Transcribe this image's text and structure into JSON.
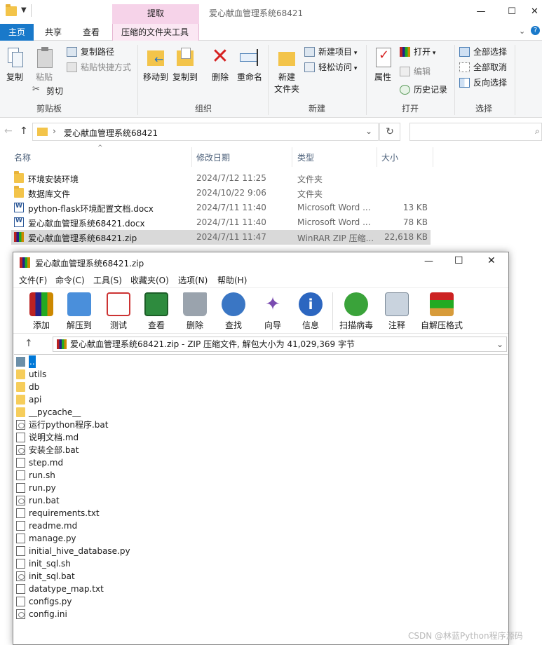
{
  "explorer": {
    "window_title": "爱心献血管理系统68421",
    "context_tab_header": "提取",
    "tabs": [
      "主页",
      "共享",
      "查看",
      "压缩的文件夹工具"
    ],
    "ribbon": {
      "clipboard": {
        "label": "剪贴板",
        "copy": "复制",
        "paste": "粘贴",
        "copy_path": "复制路径",
        "paste_shortcut": "粘贴快捷方式",
        "cut": "剪切"
      },
      "organize": {
        "label": "组织",
        "move_to": "移动到",
        "copy_to": "复制到",
        "delete": "删除",
        "rename": "重命名"
      },
      "new": {
        "label": "新建",
        "new_folder": "新建\n文件夹",
        "new_item": "新建项目",
        "easy_access": "轻松访问"
      },
      "open": {
        "label": "打开",
        "properties": "属性",
        "open": "打开",
        "edit": "编辑",
        "history": "历史记录"
      },
      "select": {
        "label": "选择",
        "select_all": "全部选择",
        "select_none": "全部取消",
        "invert": "反向选择"
      }
    },
    "address": {
      "path": "爱心献血管理系统68421"
    },
    "columns": {
      "name": "名称",
      "modified": "修改日期",
      "type": "类型",
      "size": "大小"
    },
    "files": [
      {
        "name": "环境安装环境",
        "modified": "2024/7/12 11:25",
        "type": "文件夹",
        "size": "",
        "icon": "folder-icon"
      },
      {
        "name": "数据库文件",
        "modified": "2024/10/22 9:06",
        "type": "文件夹",
        "size": "",
        "icon": "folder-icon"
      },
      {
        "name": "python-flask环境配置文档.docx",
        "modified": "2024/7/11 11:40",
        "type": "Microsoft Word ...",
        "size": "13 KB",
        "icon": "word-doc-icon"
      },
      {
        "name": "爱心献血管理系统68421.docx",
        "modified": "2024/7/11 11:40",
        "type": "Microsoft Word ...",
        "size": "78 KB",
        "icon": "word-doc-icon"
      },
      {
        "name": "爱心献血管理系统68421.zip",
        "modified": "2024/7/11 11:47",
        "type": "WinRAR ZIP 压缩...",
        "size": "22,618 KB",
        "icon": "winrar-zip-icon"
      }
    ]
  },
  "winrar": {
    "title": "爱心献血管理系统68421.zip",
    "menu": [
      "文件(F)",
      "命令(C)",
      "工具(S)",
      "收藏夹(O)",
      "选项(N)",
      "帮助(H)"
    ],
    "toolbar": [
      "添加",
      "解压到",
      "测试",
      "查看",
      "删除",
      "查找",
      "向导",
      "信息",
      "扫描病毒",
      "注释",
      "自解压格式"
    ],
    "path_text": "爱心献血管理系统68421.zip - ZIP 压缩文件, 解包大小为 41,029,369 字节",
    "items": [
      {
        "name": "..",
        "kind": "up"
      },
      {
        "name": "utils",
        "kind": "fold"
      },
      {
        "name": "db",
        "kind": "fold"
      },
      {
        "name": "api",
        "kind": "fold"
      },
      {
        "name": "__pycache__",
        "kind": "fold"
      },
      {
        "name": "运行python程序.bat",
        "kind": "bat"
      },
      {
        "name": "说明文档.md",
        "kind": "file"
      },
      {
        "name": "安装全部.bat",
        "kind": "bat"
      },
      {
        "name": "step.md",
        "kind": "file"
      },
      {
        "name": "run.sh",
        "kind": "file"
      },
      {
        "name": "run.py",
        "kind": "file"
      },
      {
        "name": "run.bat",
        "kind": "bat"
      },
      {
        "name": "requirements.txt",
        "kind": "file"
      },
      {
        "name": "readme.md",
        "kind": "file"
      },
      {
        "name": "manage.py",
        "kind": "file"
      },
      {
        "name": "initial_hive_database.py",
        "kind": "file"
      },
      {
        "name": "init_sql.sh",
        "kind": "file"
      },
      {
        "name": "init_sql.bat",
        "kind": "bat"
      },
      {
        "name": "datatype_map.txt",
        "kind": "file"
      },
      {
        "name": "configs.py",
        "kind": "file"
      },
      {
        "name": "config.ini",
        "kind": "bat"
      }
    ]
  },
  "watermark": "CSDN @林蓝Python程序源码"
}
